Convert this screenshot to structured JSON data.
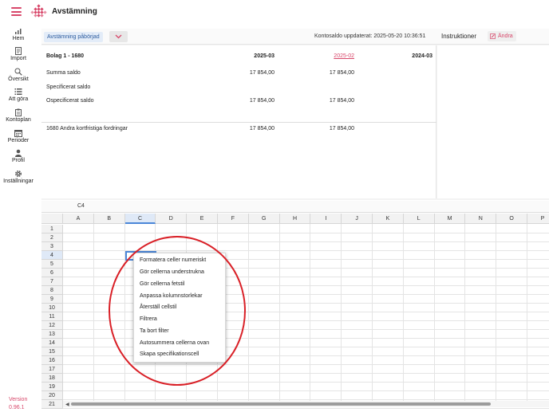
{
  "app": {
    "title": "Avstämning"
  },
  "sidebar": {
    "items": [
      {
        "label": "Hem",
        "icon": "home-icon"
      },
      {
        "label": "Import",
        "icon": "import-icon"
      },
      {
        "label": "Översikt",
        "icon": "search-icon"
      },
      {
        "label": "Att göra",
        "icon": "list-icon"
      },
      {
        "label": "Kontoplan",
        "icon": "clipboard-icon"
      },
      {
        "label": "Perioder",
        "icon": "calendar-icon"
      },
      {
        "label": "Profil",
        "icon": "user-icon"
      },
      {
        "label": "Inställningar",
        "icon": "gear-icon"
      }
    ],
    "version_label": "Version",
    "version_value": "0.96.1"
  },
  "toolbar": {
    "status_label": "Avstämning påbörjad",
    "updated_text": "Kontosaldo uppdaterat: 2025-05-20 10:36:51"
  },
  "instructions": {
    "title": "Instruktioner",
    "edit_label": "Ändra"
  },
  "summary": {
    "account": "Bolag 1 - 1680",
    "periods": [
      "2025-03",
      "2025-02",
      "2024-03"
    ],
    "rows": [
      {
        "label": "Summa saldo",
        "values": [
          "17 854,00",
          "17 854,00",
          ""
        ]
      },
      {
        "label": "Specificerat saldo",
        "values": [
          "",
          "",
          ""
        ]
      },
      {
        "label": "Ospecificerat saldo",
        "values": [
          "17 854,00",
          "17 854,00",
          ""
        ]
      }
    ],
    "account_row": {
      "label": "1680 Andra kortfristiga fordringar",
      "values": [
        "17 854,00",
        "17 854,00",
        ""
      ]
    }
  },
  "sheet": {
    "cell_ref": "C4",
    "columns": [
      "A",
      "B",
      "C",
      "D",
      "E",
      "F",
      "G",
      "H",
      "I",
      "J",
      "K",
      "L",
      "M",
      "N",
      "O",
      "P"
    ],
    "rows": [
      "1",
      "2",
      "3",
      "4",
      "5",
      "6",
      "7",
      "8",
      "9",
      "10",
      "11",
      "12",
      "13",
      "14",
      "15",
      "16",
      "17",
      "18",
      "19",
      "20",
      "21"
    ],
    "selected_column": "C",
    "selected_row": "4"
  },
  "context_menu": {
    "items": [
      "Formatera celler numeriskt",
      "Gör cellerna understrukna",
      "Gör cellerna fetstil",
      "Anpassa kolumnstorlekar",
      "Återställ cellstil",
      "Filtrera",
      "Ta bort filter",
      "Autosummera cellerna ovan",
      "Skapa specifikationscell"
    ]
  },
  "colors": {
    "accent": "#d8476a",
    "selection": "#4a86d8",
    "annotation": "#d92027"
  }
}
